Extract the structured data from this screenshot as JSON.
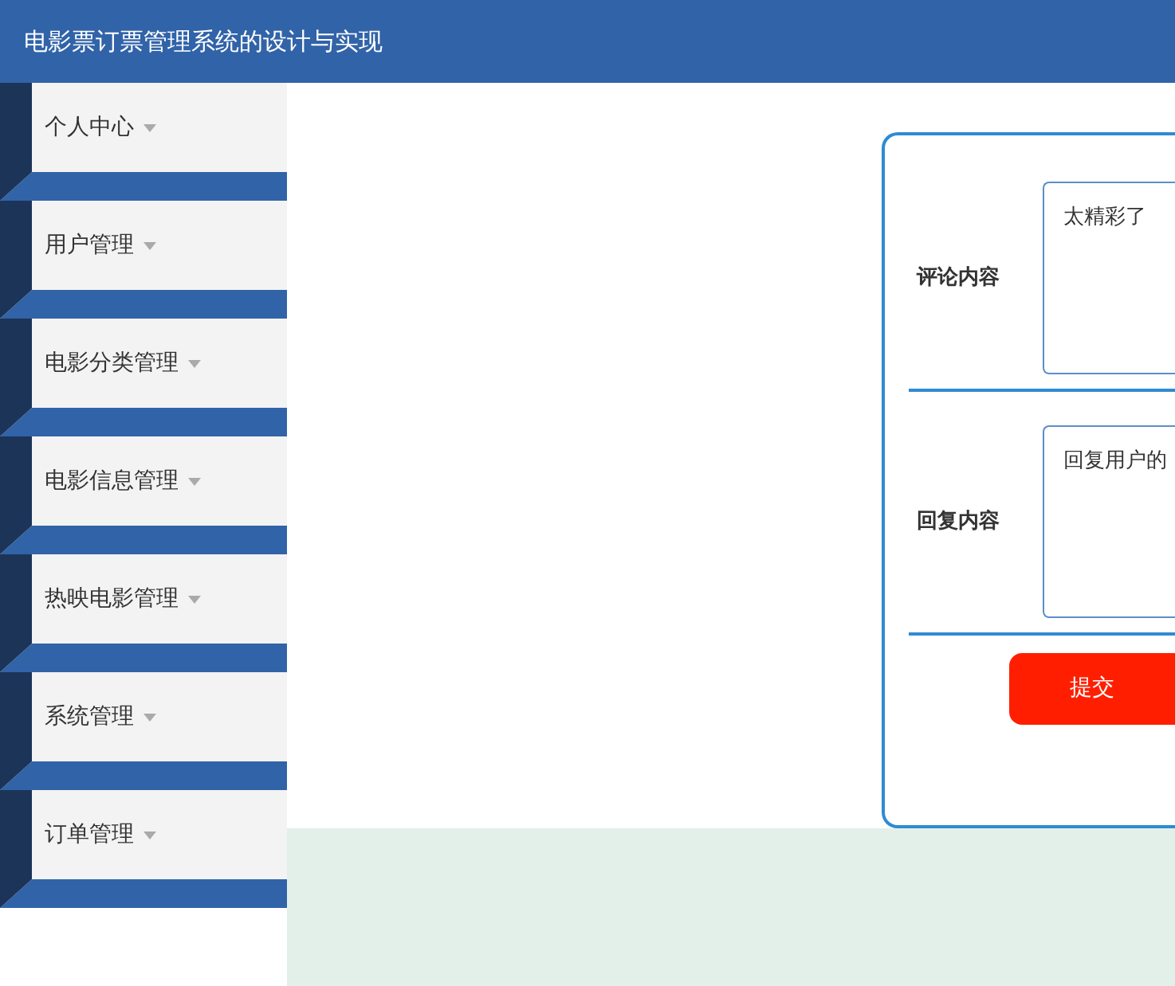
{
  "header": {
    "title": "电影票订票管理系统的设计与实现"
  },
  "sidebar": {
    "items": [
      {
        "label": "个人中心"
      },
      {
        "label": "用户管理"
      },
      {
        "label": "电影分类管理"
      },
      {
        "label": "电影信息管理"
      },
      {
        "label": "热映电影管理"
      },
      {
        "label": "系统管理"
      },
      {
        "label": "订单管理"
      }
    ]
  },
  "form": {
    "fields": [
      {
        "label": "评论内容",
        "value": "太精彩了"
      },
      {
        "label": "回复内容",
        "value": "回复用户的"
      }
    ],
    "submit": "提交"
  }
}
